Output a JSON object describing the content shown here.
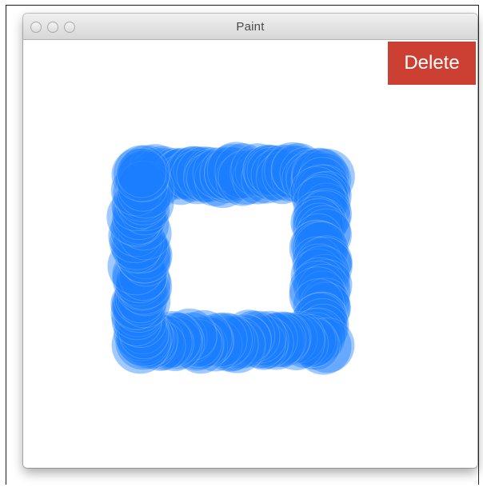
{
  "window": {
    "title": "Paint",
    "controls": [
      "close",
      "minimize",
      "zoom"
    ]
  },
  "toolbar": {
    "delete_label": "Delete",
    "delete_color": "#cc4033"
  },
  "canvas": {
    "background": "#ffffff",
    "brush_color": "#1a7fff",
    "brush_shape": "circle",
    "drawing": "square-ring"
  }
}
